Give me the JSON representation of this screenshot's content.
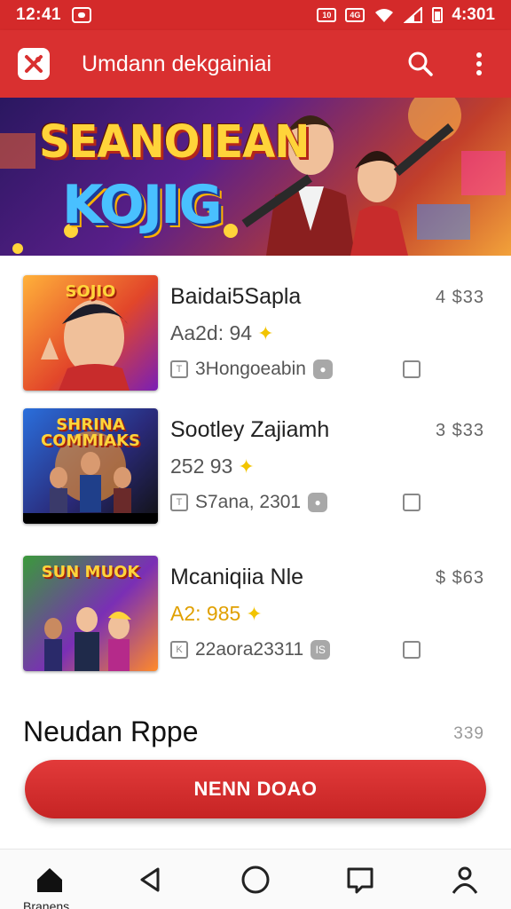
{
  "status_bar": {
    "time": "12:41",
    "right_text": "4:301",
    "box_a": "10",
    "box_b": "4G",
    "icons": [
      "notification-icon",
      "wifi-icon",
      "signal-icon",
      "battery-icon"
    ]
  },
  "app_bar": {
    "title": "Umdann dekgainiai",
    "icons": [
      "app-logo-icon",
      "search-icon",
      "more-vert-icon"
    ]
  },
  "banner": {
    "title": "SEANOIEAN",
    "subtitle": "KOJIG"
  },
  "items": [
    {
      "thumb_label": "SOJIO",
      "title": "Baidai5Sapla",
      "subtitle": "Aa2d: 94",
      "meta": "3Hongoeabin",
      "meta_badge": "",
      "price": "4 $33"
    },
    {
      "thumb_label": "SHRINA COMMIAKS",
      "title": "Sootley Zajiamh",
      "subtitle": "252 93",
      "meta": "S7ana, 2301",
      "meta_badge": "",
      "price": "3 $33"
    },
    {
      "thumb_label": "SUN MUOK",
      "title": "Mcaniqiia Nle",
      "subtitle": "A2: 985",
      "meta": "22aora23311",
      "meta_badge": "IS",
      "price": "$ $63"
    }
  ],
  "section": {
    "title": "Neudan Rppe",
    "count": "339"
  },
  "cta": {
    "label": "NENN DOAO"
  },
  "bottom_nav": {
    "home_label": "Branens",
    "icons": [
      "home-icon",
      "back-icon",
      "circle-home-icon",
      "recents-icon",
      "profile-icon"
    ]
  },
  "colors": {
    "primary": "#d93030",
    "status_bar": "#d42a2a",
    "star": "#f2c400"
  }
}
